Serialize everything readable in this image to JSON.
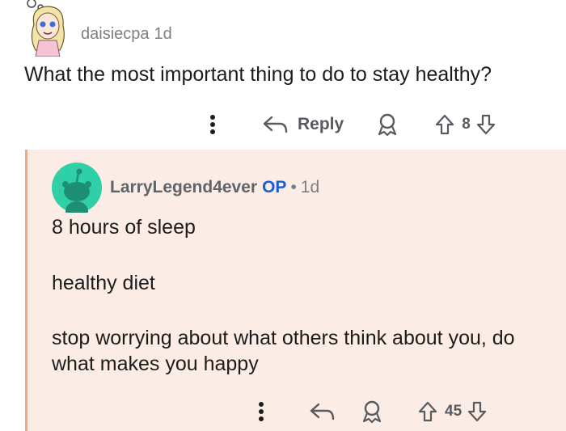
{
  "top_comment": {
    "username": "daisiecpa",
    "age": "1d",
    "body": "What the most important thing to do to stay healthy?",
    "actions": {
      "more_icon": "more-vertical-icon",
      "reply_label": "Reply",
      "award_icon": "award-icon",
      "upvote_icon": "upvote-arrow-icon",
      "score": "8",
      "downvote_icon": "downvote-arrow-icon"
    }
  },
  "reply_comment": {
    "username": "LarryLegend4ever",
    "op_badge": "OP",
    "separator": "•",
    "age": "1d",
    "paragraphs": [
      "8 hours of sleep",
      "healthy diet",
      "stop worrying about what others think about you, do what makes you happy"
    ],
    "actions": {
      "more_icon": "more-vertical-icon",
      "reply_icon": "reply-arrow-icon",
      "award_icon": "award-icon",
      "upvote_icon": "upvote-arrow-icon",
      "score": "45",
      "downvote_icon": "downvote-arrow-icon"
    }
  },
  "colors": {
    "reply_background": "#fcece6",
    "thread_line": "#f3a689",
    "op_badge": "#1a5ed6",
    "text": "#1c1c1c",
    "muted": "#7b7f83"
  }
}
